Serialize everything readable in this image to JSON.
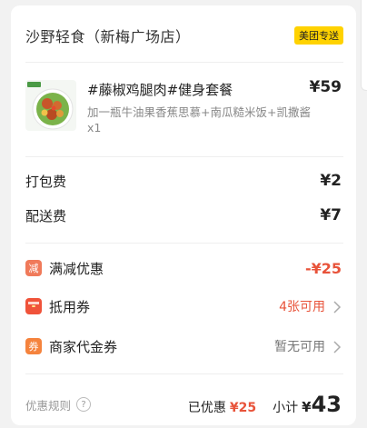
{
  "store": {
    "name": "沙野轻食（新梅广场店）",
    "badge": "美团专送"
  },
  "item": {
    "title": "#藤椒鸡腿肉#健身套餐",
    "price": "¥59",
    "desc": "加一瓶牛油果香蕉思慕+南瓜糙米饭+凯撒酱",
    "qty": "x1"
  },
  "fees": [
    {
      "label": "打包费",
      "value": "¥2"
    },
    {
      "label": "配送费",
      "value": "¥7"
    }
  ],
  "discounts": {
    "full_reduction": {
      "icon": "减",
      "label": "满减优惠",
      "value": "-¥25"
    },
    "coupon": {
      "icon": "red-envelope-icon",
      "label": "抵用券",
      "value": "4张可用"
    },
    "merchant_voucher": {
      "icon": "券",
      "label": "商家代金券",
      "value": "暂无可用"
    }
  },
  "footer": {
    "rules_label": "优惠规则",
    "rules_icon": "?",
    "saved_label": "已优惠",
    "saved_value": "¥25",
    "subtotal_label": "小计",
    "subtotal_currency": "¥",
    "subtotal_value": "43"
  },
  "colors": {
    "accent_red": "#e8533a",
    "badge_yellow": "#ffd200",
    "coupon_orange": "#f5833d"
  }
}
